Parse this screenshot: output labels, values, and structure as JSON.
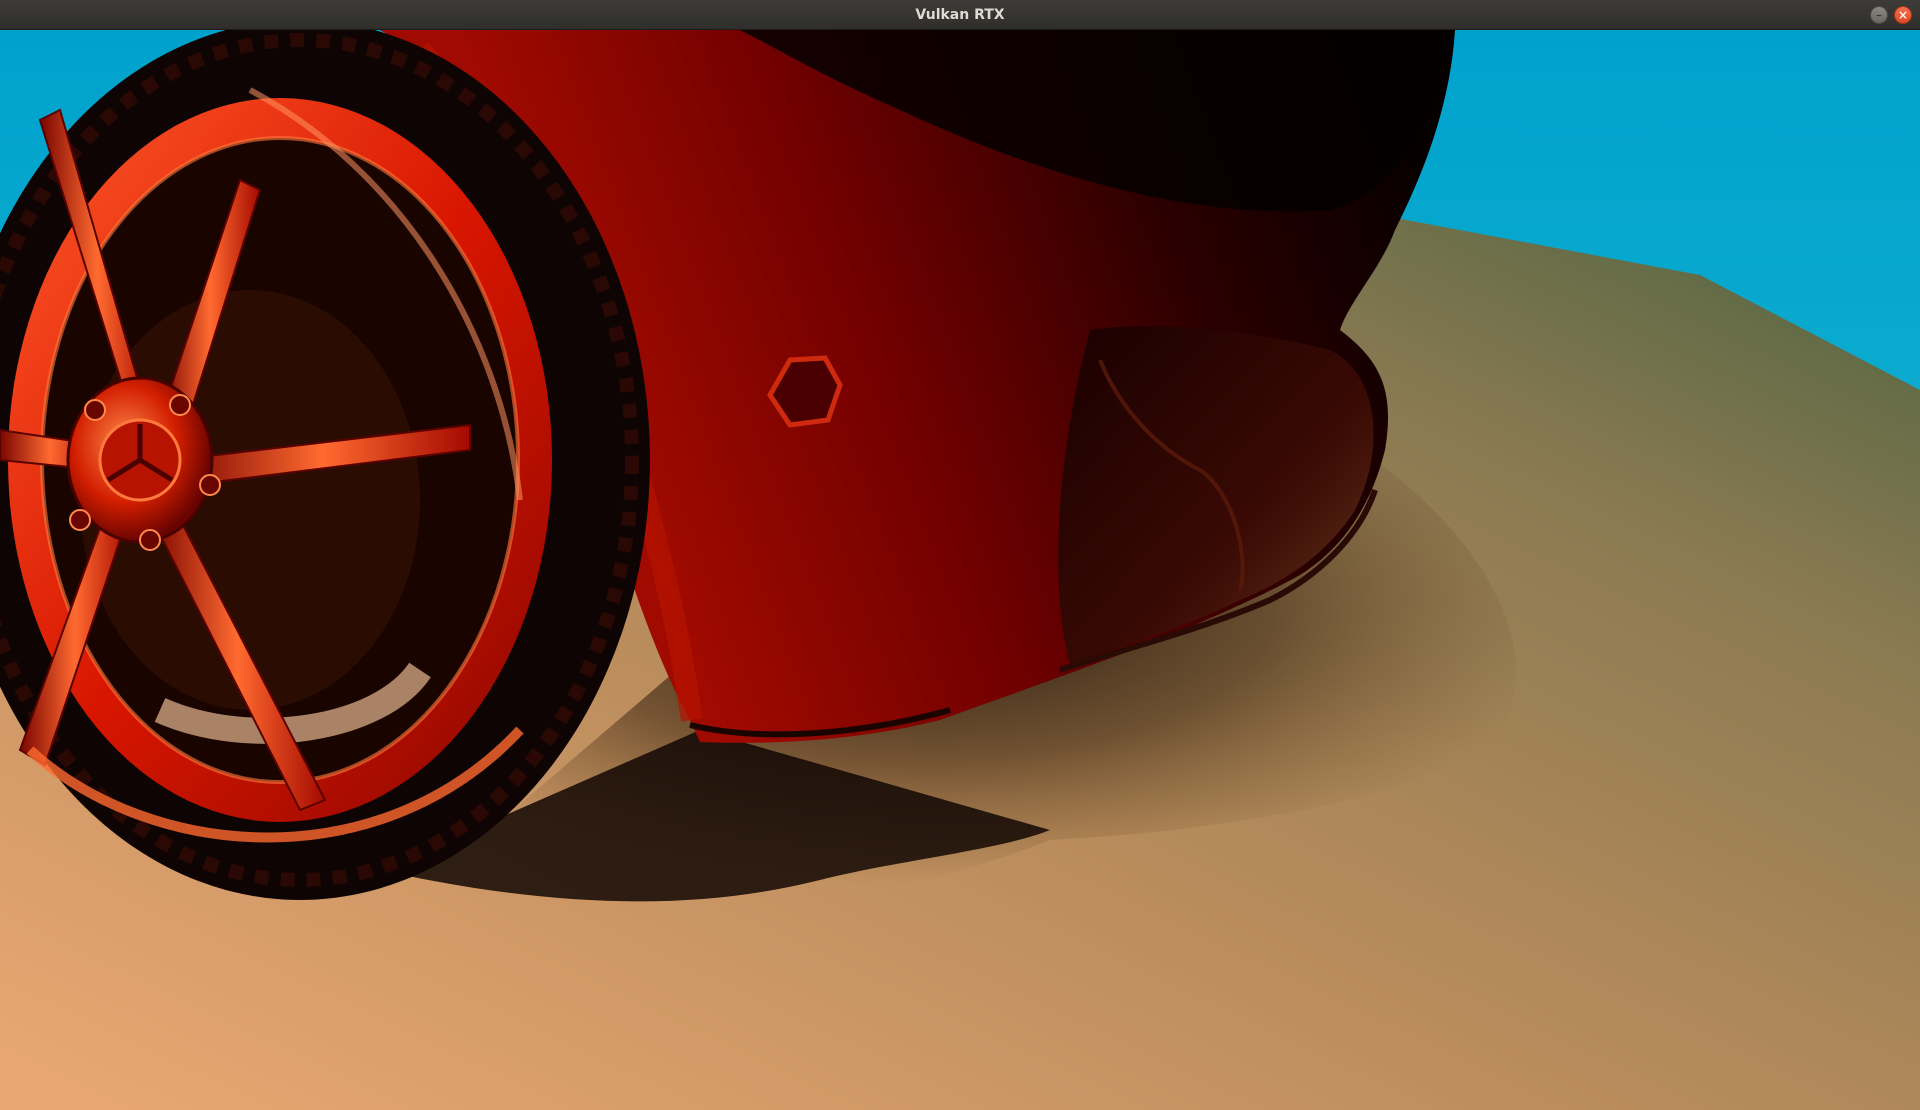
{
  "window": {
    "title": "Vulkan RTX"
  },
  "controls": {
    "minimize_glyph": "–",
    "close_glyph": "×"
  },
  "scene": {
    "description_icon": "render-viewport-icon",
    "colors": {
      "sky_top": "#00a4cc",
      "sky_bottom": "#1bb6d2",
      "ground_near": "#e2a56e",
      "ground_far": "#6d6a4e",
      "car_paint": "#8c0000",
      "car_shadow": "#1e0000",
      "wheel_red": "#e01a00",
      "wheel_highlight": "#ff7a3c",
      "tire_black": "#120606"
    }
  }
}
